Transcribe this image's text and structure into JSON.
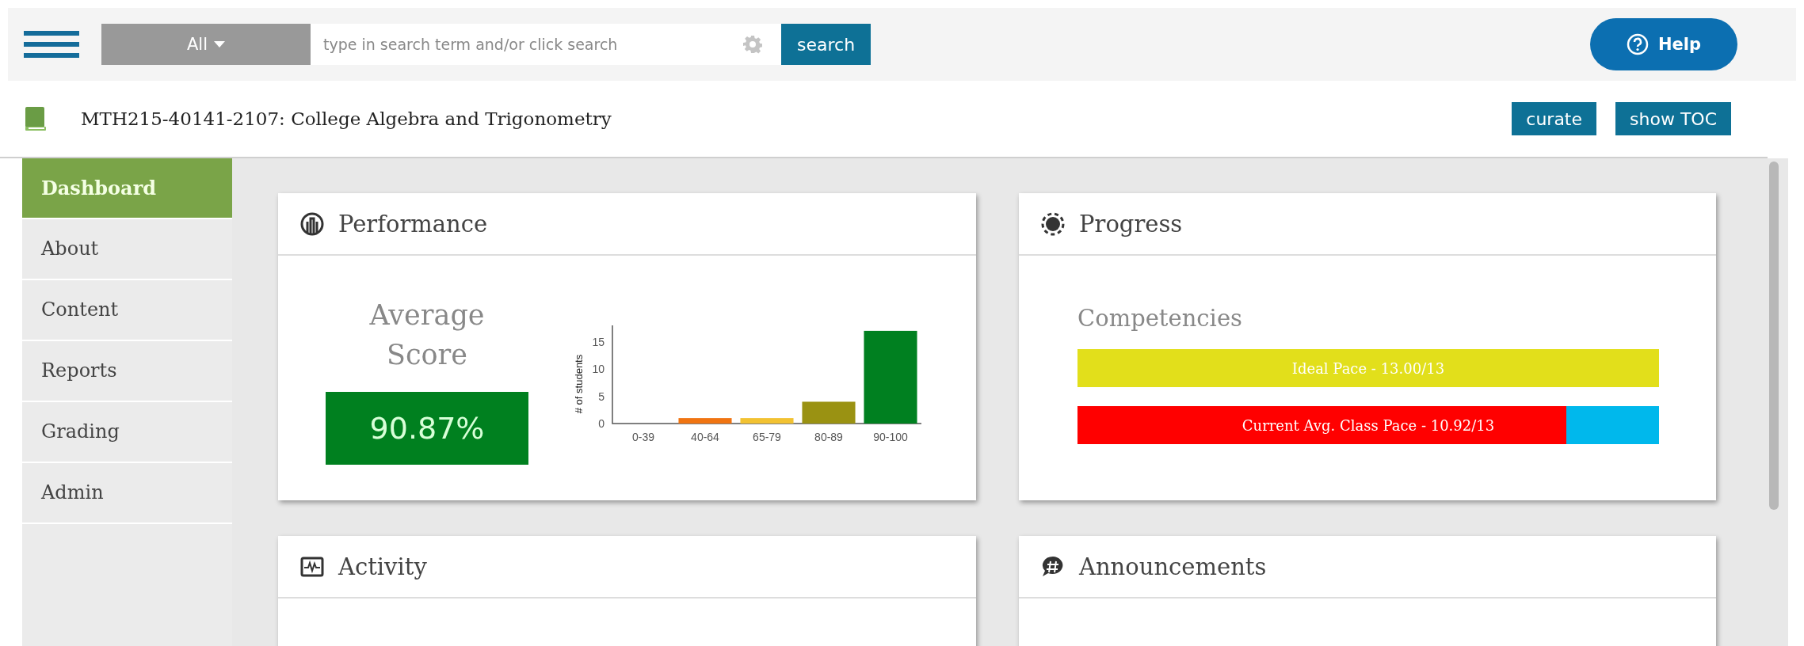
{
  "top_bar": {
    "scope": "All",
    "search": {
      "placeholder": "type in search term and/or click search"
    },
    "search_button": "search",
    "help_button": "Help"
  },
  "course": {
    "title": "MTH215-40141-2107: College Algebra and Trigonometry",
    "buttons": [
      "curate",
      "show TOC"
    ]
  },
  "sidebar": {
    "items": [
      {
        "label": "Dashboard",
        "selected": true
      },
      {
        "label": "About",
        "selected": false
      },
      {
        "label": "Content",
        "selected": false
      },
      {
        "label": "Reports",
        "selected": false
      },
      {
        "label": "Grading",
        "selected": false
      },
      {
        "label": "Admin",
        "selected": false
      }
    ]
  },
  "cards": [
    {
      "kind": "performance",
      "title": "Performance",
      "score_label": "Average Score",
      "score": "90.87%",
      "chart_data": {
        "type": "bar",
        "ylabel": "# of students",
        "categories": [
          "0-39",
          "40-64",
          "65-79",
          "80-89",
          "90-100"
        ],
        "ylim": [
          0,
          18
        ],
        "yticks": [
          0,
          5,
          10,
          15
        ],
        "values": [
          0,
          1,
          1,
          4,
          17
        ],
        "colors": [
          null,
          "#f07412",
          "#f2c232",
          "#9a9212",
          "#008020"
        ]
      }
    },
    {
      "kind": "progress",
      "title": "Progress",
      "subtitle": "Competencies",
      "bars": [
        {
          "label": "Ideal Pace - 13.00/13",
          "level": 1.0,
          "color": "#e2df1b"
        },
        {
          "label": "Current Avg. Class Pace - 10.92/13",
          "level": 0.84,
          "color": "#ff0000"
        }
      ]
    },
    {
      "kind": "activity",
      "title": "Activity"
    },
    {
      "kind": "announcements",
      "title": "Announcements"
    }
  ]
}
